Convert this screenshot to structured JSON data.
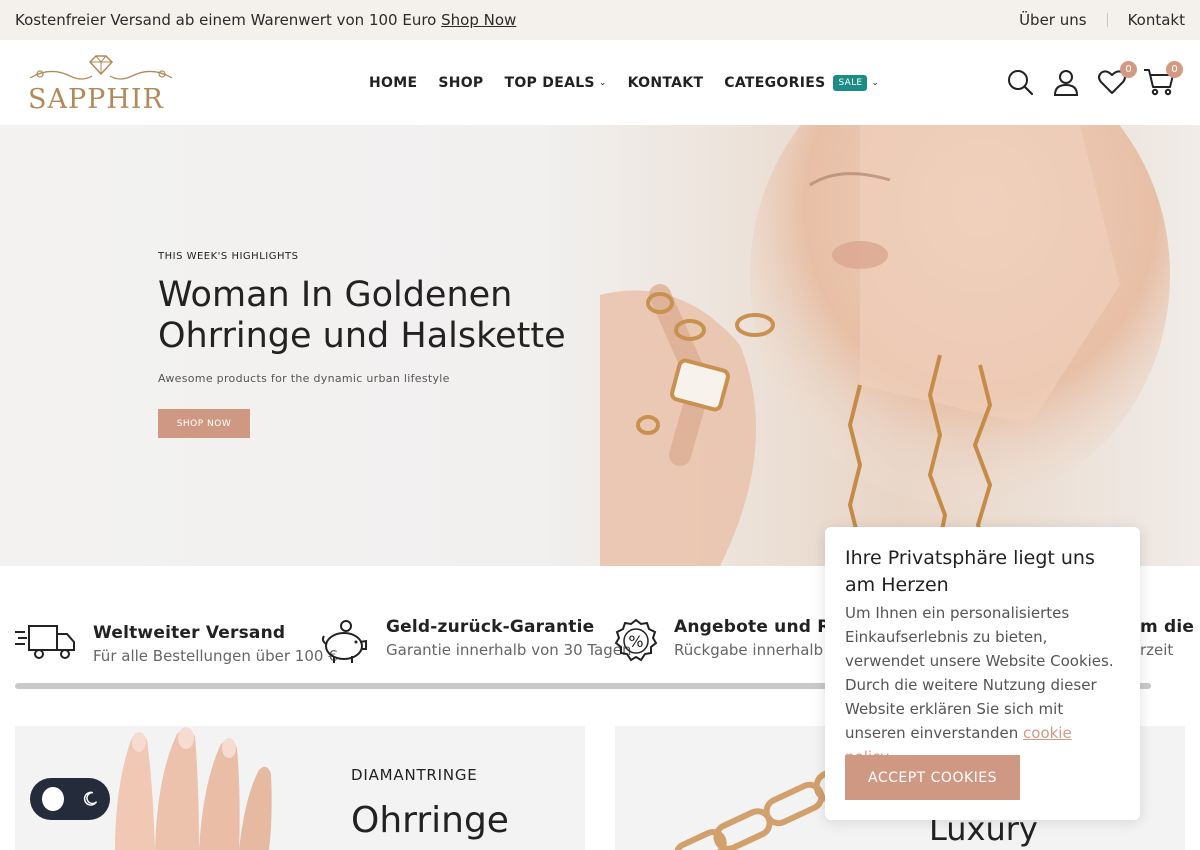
{
  "topbar": {
    "promo_text": "Kostenfreier Versand ab einem Warenwert von 100 Euro",
    "promo_link": "Shop Now",
    "links": [
      "Über uns",
      "Kontakt"
    ]
  },
  "header": {
    "logo_text": "SAPPHIR",
    "nav": [
      {
        "label": "HOME"
      },
      {
        "label": "SHOP"
      },
      {
        "label": "TOP DEALS"
      },
      {
        "label": "KONTAKT"
      },
      {
        "label": "CATEGORIES",
        "badge": "SALE"
      }
    ],
    "wishlist_count": "0",
    "cart_count": "0"
  },
  "hero": {
    "eyebrow": "THIS WEEK'S HIGHLIGHTS",
    "title_line1": "Woman In Goldenen",
    "title_line2": "Ohrringe und Halskette",
    "subtitle": "Awesome products for the dynamic urban lifestyle",
    "button": "SHOP NOW"
  },
  "features": [
    {
      "icon": "truck-icon",
      "title": "Weltweiter Versand",
      "desc": "Für alle Bestellungen über 100 €"
    },
    {
      "icon": "piggy-bank-icon",
      "title": "Geld-zurück-Garantie",
      "desc": "Garantie innerhalb von 30 Tagen"
    },
    {
      "icon": "percent-badge-icon",
      "title": "Angebote und Raba",
      "desc": "Rückgabe innerhalb v"
    },
    {
      "icon": "",
      "title": "m die",
      "desc": "rzeit"
    }
  ],
  "banners": {
    "left": {
      "eyebrow": "DIAMANTRINGE",
      "title": "Ohrringe"
    },
    "right": {
      "title": "Luxury Armband"
    }
  },
  "cookie": {
    "title": "Ihre Privatsphäre liegt uns am Herzen",
    "text": "Um Ihnen ein personalisiertes Einkaufserlebnis zu bieten, verwendet unsere Website Cookies. Durch die weitere Nutzung dieser Website erklären Sie sich mit unseren einverstanden",
    "link": "cookie policy.",
    "button": "ACCEPT COOKIES"
  },
  "colors": {
    "accent": "#cf9883",
    "sale_badge": "#1e8c86",
    "logo_gold": "#b38a57",
    "topbar_bg": "#f4f1ed"
  }
}
